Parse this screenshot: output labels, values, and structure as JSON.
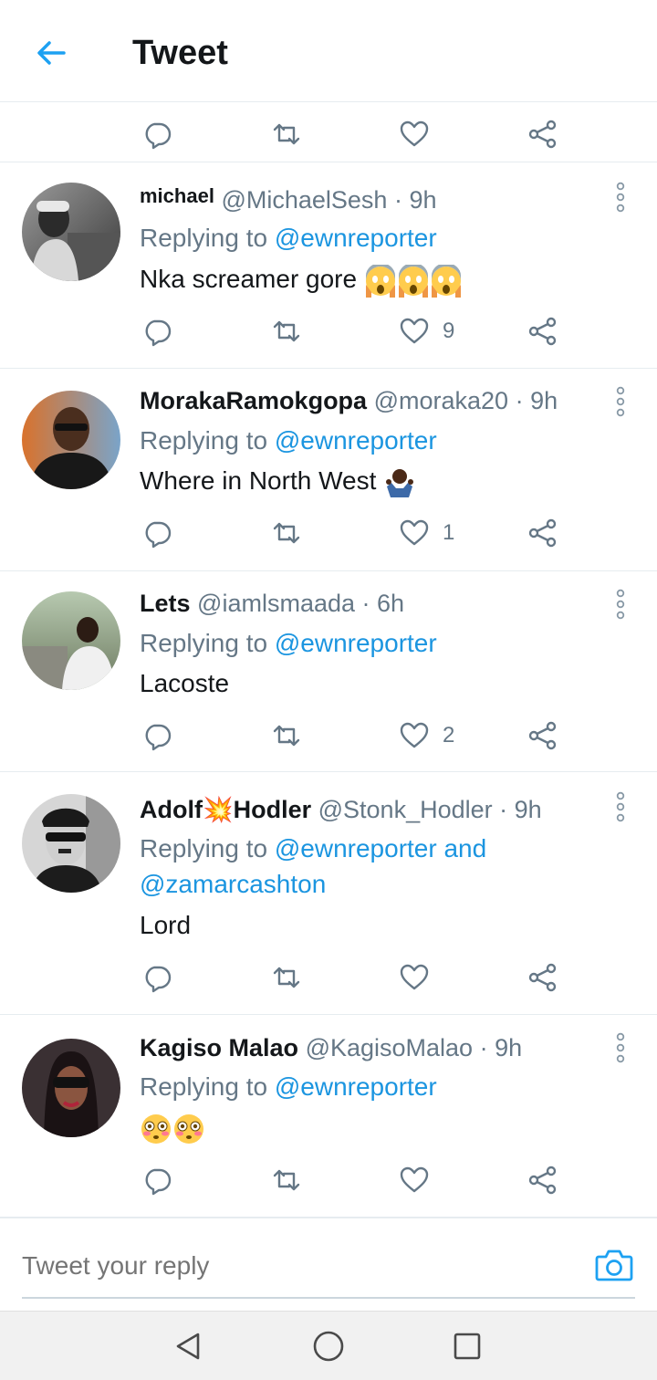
{
  "header": {
    "title": "Tweet",
    "back_icon": "arrow-left-icon",
    "accent": "#1da1f2"
  },
  "tweets": [
    {
      "name": "michael",
      "handle": "@MichaelSesh",
      "time": "· 9h",
      "replying_prefix": "Replying to ",
      "mentions": "@ewnreporter",
      "text": "Nka screamer gore",
      "emojis": [
        "screaming-face",
        "screaming-face",
        "screaming-face"
      ],
      "likes": "9"
    },
    {
      "name": "MorakaRamokgopa",
      "handle": "@moraka20",
      "time": "· 9h",
      "replying_prefix": "Replying to ",
      "mentions": "@ewnreporter",
      "text": "Where in North West",
      "emojis": [
        "person-shrugging"
      ],
      "likes": "1"
    },
    {
      "name": "Lets",
      "handle": "@iamlsmaada",
      "time": "· 6h",
      "replying_prefix": "Replying to ",
      "mentions": "@ewnreporter",
      "text": "Lacoste",
      "emojis": [],
      "likes": "2"
    },
    {
      "name": "Adolf💥Hodler",
      "handle": "@Stonk_Hodler",
      "time": "· 9h",
      "replying_prefix": "Replying to ",
      "mentions": "@ewnreporter and @zamarcashton",
      "text": "Lord",
      "emojis": [],
      "likes": ""
    },
    {
      "name": "Kagiso Malao",
      "handle": "@KagisoMalao",
      "time": "· 9h",
      "replying_prefix": "Replying to ",
      "mentions": "@ewnreporter",
      "text": "",
      "emojis": [
        "flushed-face",
        "flushed-face"
      ],
      "likes": ""
    }
  ],
  "compose": {
    "placeholder": "Tweet your reply",
    "camera_icon": "camera-icon"
  },
  "navbar": {
    "icons": [
      "nav-back-icon",
      "nav-home-icon",
      "nav-recents-icon"
    ]
  },
  "colors": {
    "link": "#1b95e0",
    "muted": "#657786",
    "text": "#14171a",
    "divider": "#e6ecf0"
  }
}
